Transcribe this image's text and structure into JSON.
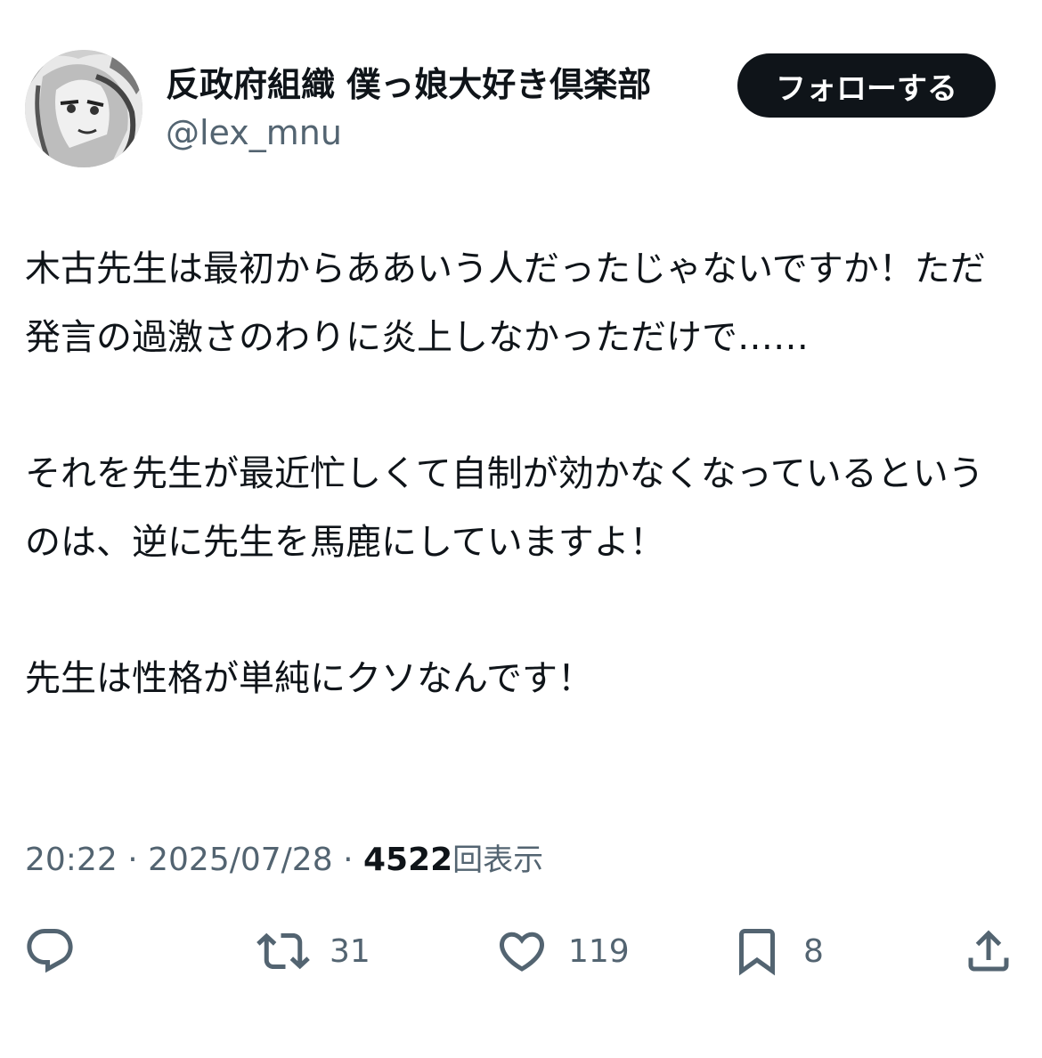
{
  "author": {
    "display_name": "反政府組織 僕っ娘大好き倶楽部",
    "handle": "@lex_mnu",
    "avatar_icon": "user-avatar-icon"
  },
  "follow_button": {
    "label": "フォローする"
  },
  "tweet": {
    "paragraphs": [
      "木古先生は最初からああいう人だったじゃないですか！ただ発言の過激さのわりに炎上しなかっただけで……",
      "それを先生が最近忙しくて自制が効かなくなっているというのは、逆に先生を馬鹿にしていますよ！",
      "先生は性格が単純にクソなんです！"
    ]
  },
  "meta": {
    "time": "20:22",
    "separator": "·",
    "date": "2025/07/28",
    "views_count": "4522",
    "views_label": "回表示"
  },
  "actions": {
    "reply": {
      "icon": "reply-icon",
      "count": ""
    },
    "retweet": {
      "icon": "retweet-icon",
      "count": "31"
    },
    "like": {
      "icon": "heart-icon",
      "count": "119"
    },
    "bookmark": {
      "icon": "bookmark-icon",
      "count": "8"
    },
    "share": {
      "icon": "share-icon",
      "count": ""
    }
  },
  "colors": {
    "text_primary": "#0f1419",
    "text_secondary": "#536471",
    "button_bg": "#0f1419",
    "button_text": "#ffffff",
    "background": "#ffffff"
  }
}
